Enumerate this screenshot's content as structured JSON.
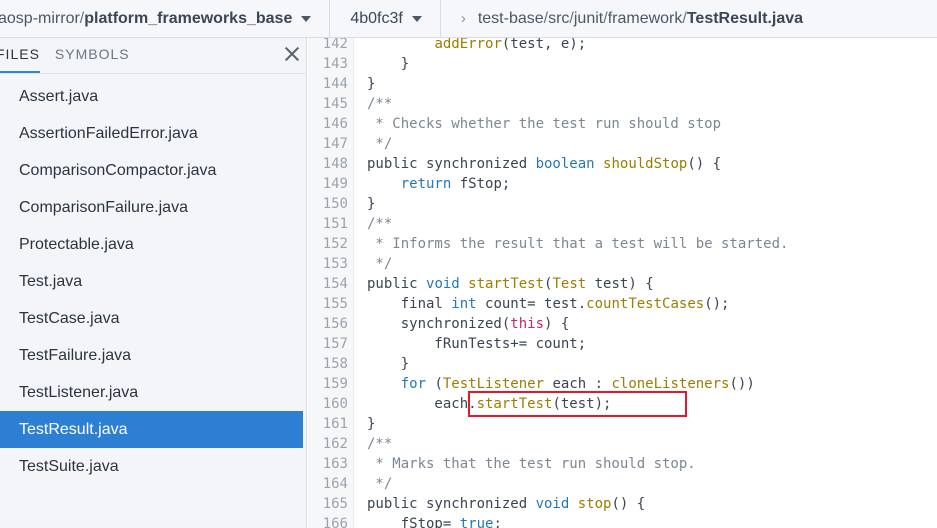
{
  "header": {
    "repo_owner": "aosp-mirror",
    "slash": "/",
    "repo_name": "platform_frameworks_base",
    "revision": "4b0fc3f",
    "chevron": "›",
    "path": [
      {
        "text": "test-base"
      },
      {
        "text": "src"
      },
      {
        "text": "junit"
      },
      {
        "text": "framework"
      }
    ],
    "file": "TestResult.java"
  },
  "sidebar": {
    "tabs": [
      {
        "label": "FILES",
        "active": true
      },
      {
        "label": "SYMBOLS",
        "active": false
      }
    ],
    "files": [
      "Assert.java",
      "AssertionFailedError.java",
      "ComparisonCompactor.java",
      "ComparisonFailure.java",
      "Protectable.java",
      "Test.java",
      "TestCase.java",
      "TestFailure.java",
      "TestListener.java",
      "TestResult.java",
      "TestSuite.java"
    ],
    "selected_file": "TestResult.java"
  },
  "code": {
    "lines": [
      {
        "n": "142",
        "t": [
          [
            "",
            "        "
          ],
          [
            "fn",
            "addError"
          ],
          [
            "",
            "(test, e);"
          ]
        ]
      },
      {
        "n": "143",
        "t": [
          [
            "",
            "    }"
          ]
        ]
      },
      {
        "n": "144",
        "t": [
          [
            "",
            "}"
          ]
        ]
      },
      {
        "n": "145",
        "t": [
          [
            "cm",
            "/**"
          ]
        ]
      },
      {
        "n": "146",
        "t": [
          [
            "cm",
            " * Checks whether the test run should stop"
          ]
        ]
      },
      {
        "n": "147",
        "t": [
          [
            "cm",
            " */"
          ]
        ]
      },
      {
        "n": "148",
        "t": [
          [
            "",
            "public synchronized "
          ],
          [
            "kw",
            "boolean"
          ],
          [
            "",
            " "
          ],
          [
            "fn",
            "shouldStop"
          ],
          [
            "",
            "() {"
          ]
        ]
      },
      {
        "n": "149",
        "t": [
          [
            "",
            "    "
          ],
          [
            "kw",
            "return"
          ],
          [
            "",
            " fStop;"
          ]
        ]
      },
      {
        "n": "150",
        "t": [
          [
            "",
            "}"
          ]
        ]
      },
      {
        "n": "151",
        "t": [
          [
            "cm",
            "/**"
          ]
        ]
      },
      {
        "n": "152",
        "t": [
          [
            "cm",
            " * Informs the result that a test will be started."
          ]
        ]
      },
      {
        "n": "153",
        "t": [
          [
            "cm",
            " */"
          ]
        ]
      },
      {
        "n": "154",
        "t": [
          [
            "",
            "public "
          ],
          [
            "kw",
            "void"
          ],
          [
            "",
            " "
          ],
          [
            "fn",
            "startTest"
          ],
          [
            "",
            "("
          ],
          [
            "fn",
            "Test"
          ],
          [
            "",
            " test) {"
          ]
        ]
      },
      {
        "n": "155",
        "t": [
          [
            "",
            "    final "
          ],
          [
            "kw",
            "int"
          ],
          [
            "",
            " count= test."
          ],
          [
            "fn",
            "countTestCases"
          ],
          [
            "",
            "();"
          ]
        ]
      },
      {
        "n": "156",
        "t": [
          [
            "",
            "    synchronized("
          ],
          [
            "th",
            "this"
          ],
          [
            "",
            ") {"
          ]
        ]
      },
      {
        "n": "157",
        "t": [
          [
            "",
            "        fRunTests+= count;"
          ]
        ]
      },
      {
        "n": "158",
        "t": [
          [
            "",
            "    }"
          ]
        ]
      },
      {
        "n": "159",
        "t": [
          [
            "",
            "    "
          ],
          [
            "kw",
            "for"
          ],
          [
            "",
            " ("
          ],
          [
            "fn",
            "TestListener"
          ],
          [
            "",
            " each : "
          ],
          [
            "fn",
            "cloneListeners"
          ],
          [
            "",
            "())"
          ]
        ]
      },
      {
        "n": "160",
        "t": [
          [
            "",
            "        each."
          ],
          [
            "fn",
            "startTest"
          ],
          [
            "",
            "(test);"
          ]
        ]
      },
      {
        "n": "161",
        "t": [
          [
            "",
            "}"
          ]
        ]
      },
      {
        "n": "162",
        "t": [
          [
            "cm",
            "/**"
          ]
        ]
      },
      {
        "n": "163",
        "t": [
          [
            "cm",
            " * Marks that the test run should stop."
          ]
        ]
      },
      {
        "n": "164",
        "t": [
          [
            "cm",
            " */"
          ]
        ]
      },
      {
        "n": "165",
        "t": [
          [
            "",
            "public synchronized "
          ],
          [
            "kw",
            "void"
          ],
          [
            "",
            " "
          ],
          [
            "fn",
            "stop"
          ],
          [
            "",
            "() {"
          ]
        ]
      },
      {
        "n": "166",
        "t": [
          [
            "",
            "    fStop= "
          ],
          [
            "kw",
            "true"
          ],
          [
            "",
            ";"
          ]
        ]
      }
    ],
    "highlighted_line": "160"
  },
  "colors": {
    "selection": "#2d7fd3",
    "keyword": "#2678b5",
    "function": "#9c7d00",
    "comment": "#7d8791",
    "this": "#c22a6a",
    "highlight_box": "#e0192b"
  }
}
